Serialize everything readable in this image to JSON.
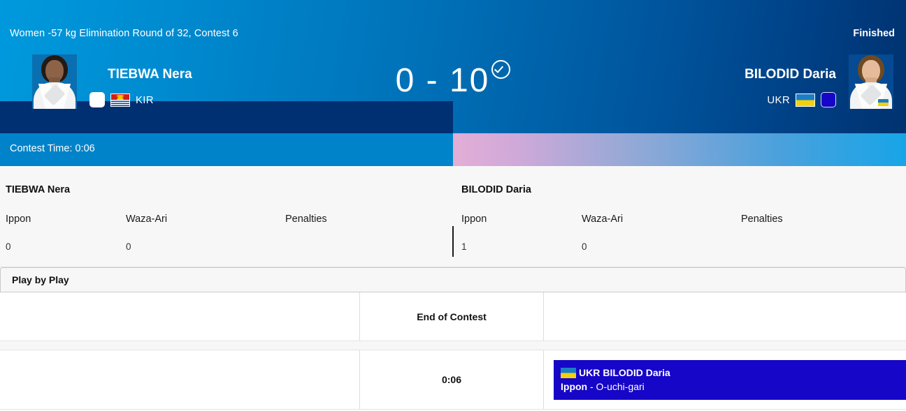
{
  "header": {
    "contest_title": "Women -57 kg Elimination Round of 32, Contest 6",
    "status": "Finished",
    "score_text": "0 - 10",
    "check_icon": "check-circle-icon",
    "contest_time_label": "Contest Time: 0:06"
  },
  "athletes": {
    "left": {
      "name": "TIEBWA Nera",
      "noc": "KIR",
      "gi_color": "white",
      "flag": "kiribati-flag"
    },
    "right": {
      "name": "BILODID Daria",
      "noc": "UKR",
      "gi_color": "blue",
      "flag": "ukraine-flag"
    }
  },
  "stats": {
    "columns": [
      "Ippon",
      "Waza-Ari",
      "Penalties"
    ],
    "left": {
      "name": "TIEBWA Nera",
      "ippon": "0",
      "waza_ari": "0",
      "penalties": ""
    },
    "right": {
      "name": "BILODID Daria",
      "ippon": "1",
      "waza_ari": "0",
      "penalties": ""
    }
  },
  "tabs": {
    "play_by_play": "Play by Play"
  },
  "play_by_play": {
    "rows": [
      {
        "left": "",
        "time": "End of Contest",
        "event": null
      },
      {
        "left": "",
        "time": "0:06",
        "event": {
          "noc": "UKR",
          "athlete": "BILODID Daria",
          "score_type": "Ippon",
          "technique": "- O-uchi-gari",
          "flag": "ukraine-flag",
          "color": "#1606c8"
        }
      }
    ]
  },
  "colors": {
    "header_start": "#0099dd",
    "header_end": "#00316e",
    "navy_band": "#002f72",
    "time_bar": "#0083c9",
    "event_blue": "#1606c8",
    "panel_bg": "#f7f7f7"
  }
}
